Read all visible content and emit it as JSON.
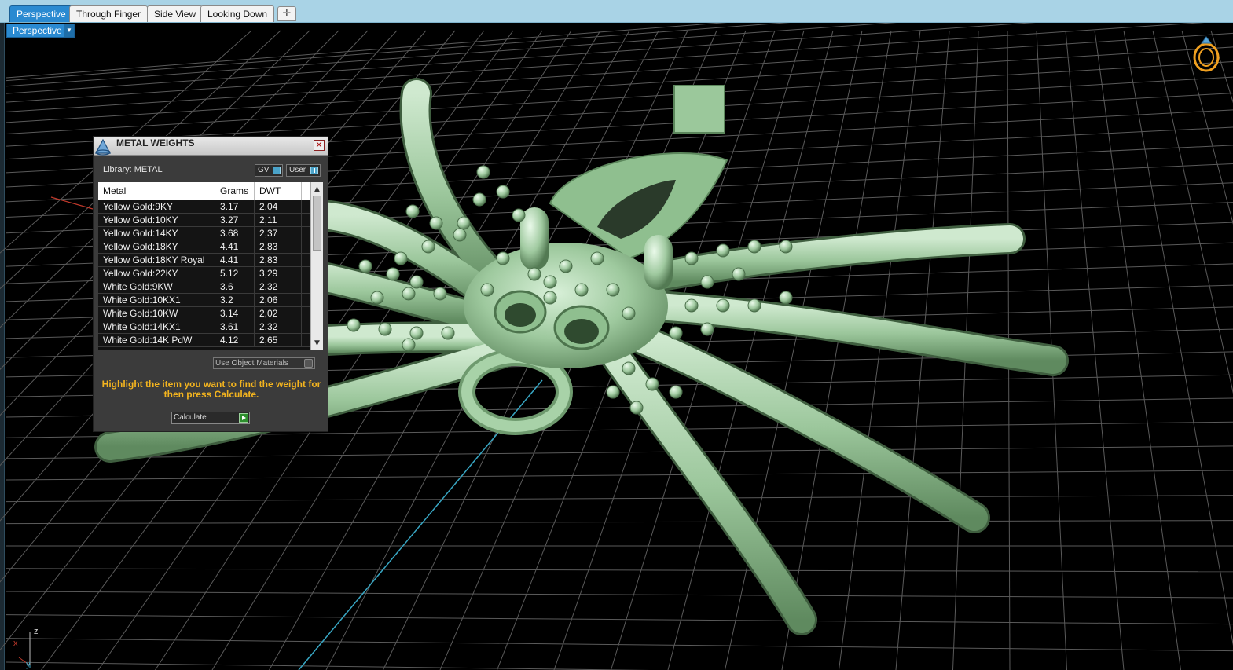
{
  "tabs": [
    {
      "label": "Perspective",
      "active": true
    },
    {
      "label": "Through Finger",
      "active": false
    },
    {
      "label": "Side View",
      "active": false
    },
    {
      "label": "Looking Down",
      "active": false
    }
  ],
  "tab_add_icon": "plus-icon",
  "viewport": {
    "mode_label": "Perspective",
    "axis_labels": {
      "z": "z",
      "x": "x",
      "y": "y"
    },
    "grid_color": "#5a5a5a",
    "model_color": "#9fcf9f"
  },
  "panel": {
    "title": "METAL WEIGHTS",
    "library_label": "Library: METAL",
    "gv_label": "GV",
    "user_label": "User",
    "columns": [
      "Metal",
      "Grams",
      "DWT"
    ],
    "rows": [
      {
        "metal": "Yellow Gold:9KY",
        "grams": "3.17",
        "dwt": "2,04"
      },
      {
        "metal": "Yellow Gold:10KY",
        "grams": "3.27",
        "dwt": "2,11"
      },
      {
        "metal": "Yellow Gold:14KY",
        "grams": "3.68",
        "dwt": "2,37"
      },
      {
        "metal": "Yellow Gold:18KY",
        "grams": "4.41",
        "dwt": "2,83"
      },
      {
        "metal": "Yellow Gold:18KY Royal",
        "grams": "4.41",
        "dwt": "2,83"
      },
      {
        "metal": "Yellow Gold:22KY",
        "grams": "5.12",
        "dwt": "3,29"
      },
      {
        "metal": "White Gold:9KW",
        "grams": "3.6",
        "dwt": "2,32"
      },
      {
        "metal": "White Gold:10KX1",
        "grams": "3.2",
        "dwt": "2,06"
      },
      {
        "metal": "White Gold:10KW",
        "grams": "3.14",
        "dwt": "2,02"
      },
      {
        "metal": "White Gold:14KX1",
        "grams": "3.61",
        "dwt": "2,32"
      },
      {
        "metal": "White Gold:14K PdW",
        "grams": "4.12",
        "dwt": "2,65"
      }
    ],
    "use_object_materials": "Use Object Materials",
    "hint": "Highlight the item you want to find the weight for then press Calculate.",
    "calculate_label": "Calculate",
    "accent": "#f3b41f"
  }
}
